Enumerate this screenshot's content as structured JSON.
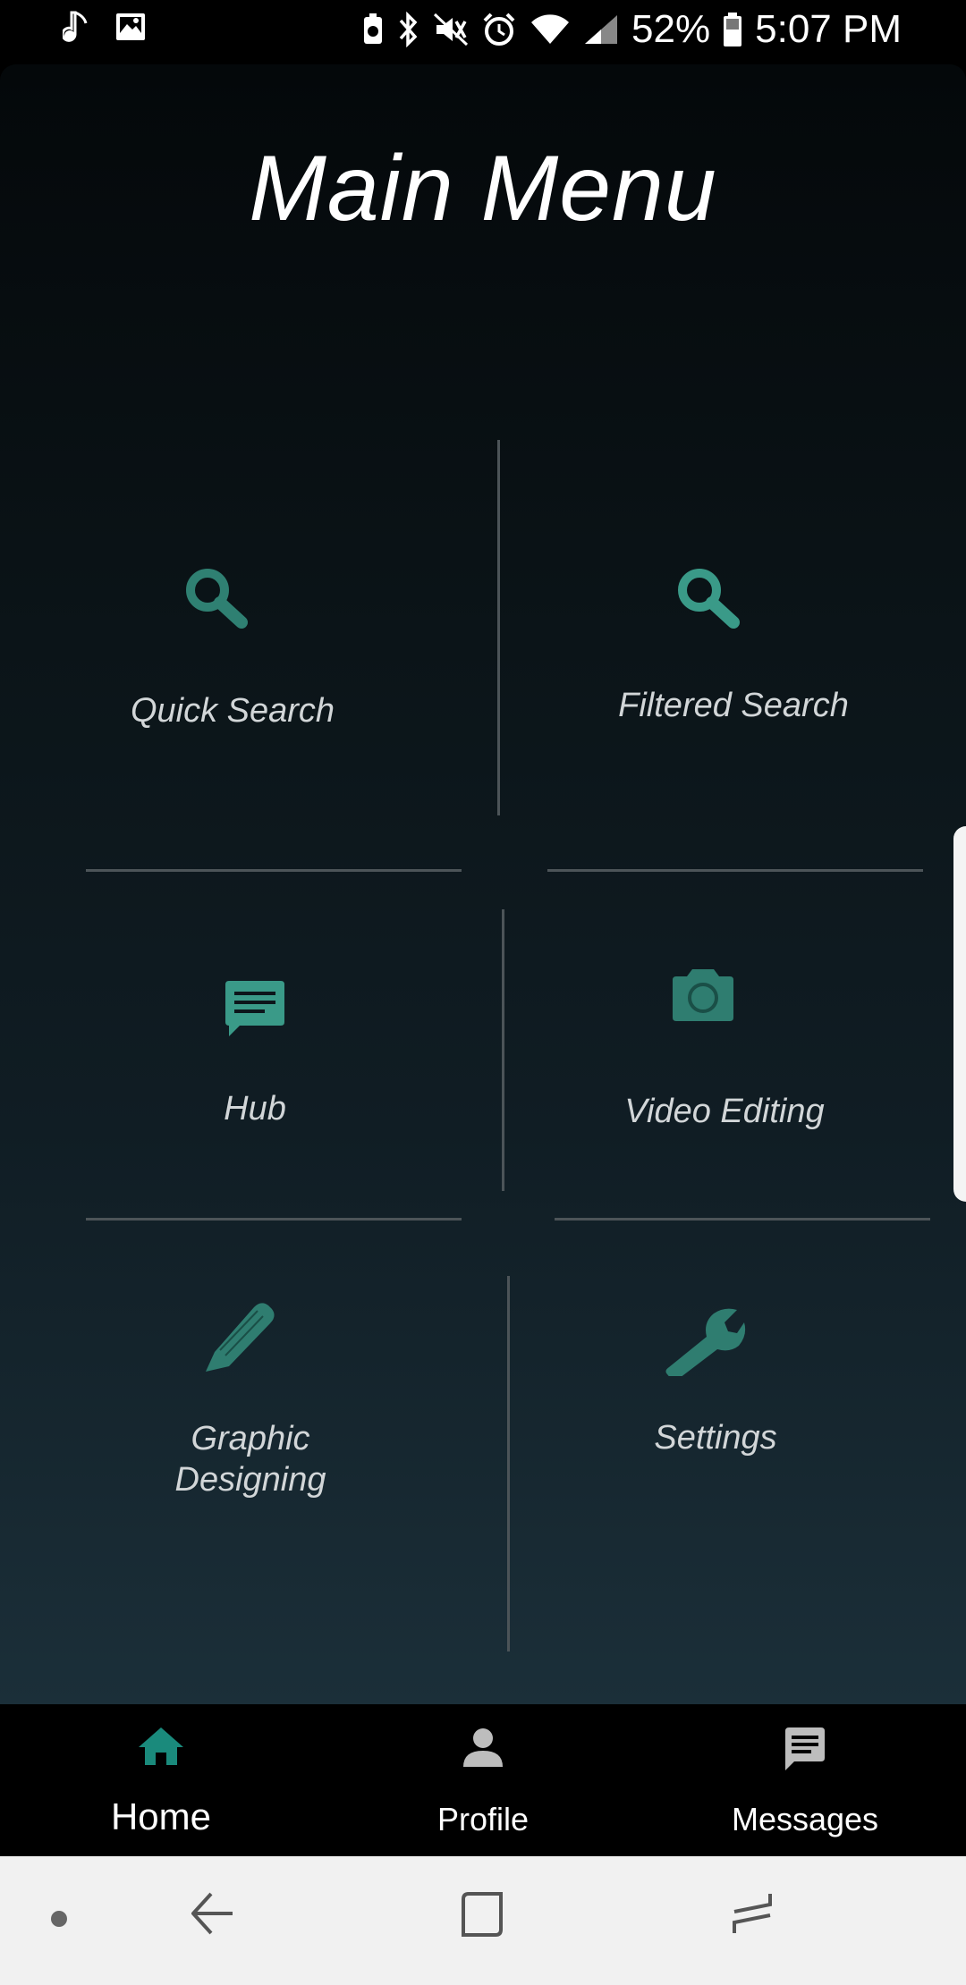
{
  "status_bar": {
    "icons_left": [
      "music-note-icon",
      "image-icon"
    ],
    "icons_right": [
      "battery-saver-icon",
      "bluetooth-icon",
      "mute-icon",
      "alarm-icon",
      "wifi-icon",
      "signal-icon",
      "battery-icon"
    ],
    "battery": "52%",
    "time": "5:07 PM"
  },
  "page": {
    "title": "Main Menu"
  },
  "menu": {
    "quick_search": {
      "label": "Quick Search",
      "icon": "search-icon"
    },
    "filtered_search": {
      "label": "Filtered Search",
      "icon": "search-icon"
    },
    "hub": {
      "label": "Hub",
      "icon": "chat-icon"
    },
    "video_editing": {
      "label": "Video Editing",
      "icon": "camera-icon"
    },
    "graphic_designing": {
      "label_line1": "Graphic",
      "label_line2": "Designing",
      "icon": "pencil-icon"
    },
    "settings": {
      "label": "Settings",
      "icon": "wrench-icon"
    }
  },
  "bottom_nav": {
    "items": [
      {
        "label": "Home",
        "icon": "home-icon",
        "active": true
      },
      {
        "label": "Profile",
        "icon": "person-icon",
        "active": false
      },
      {
        "label": "Messages",
        "icon": "message-icon",
        "active": false
      }
    ]
  },
  "system_nav": {
    "buttons": [
      "dot-icon",
      "back-icon",
      "recents-icon",
      "home-button-icon"
    ]
  },
  "colors": {
    "accent": "#2e8f7f",
    "icon_teal": "#2f7d70",
    "label_grey": "#d2d6d8",
    "divider": "#4c5458",
    "nav_bg": "#000000",
    "system_nav_bg": "#f1f1f1"
  }
}
